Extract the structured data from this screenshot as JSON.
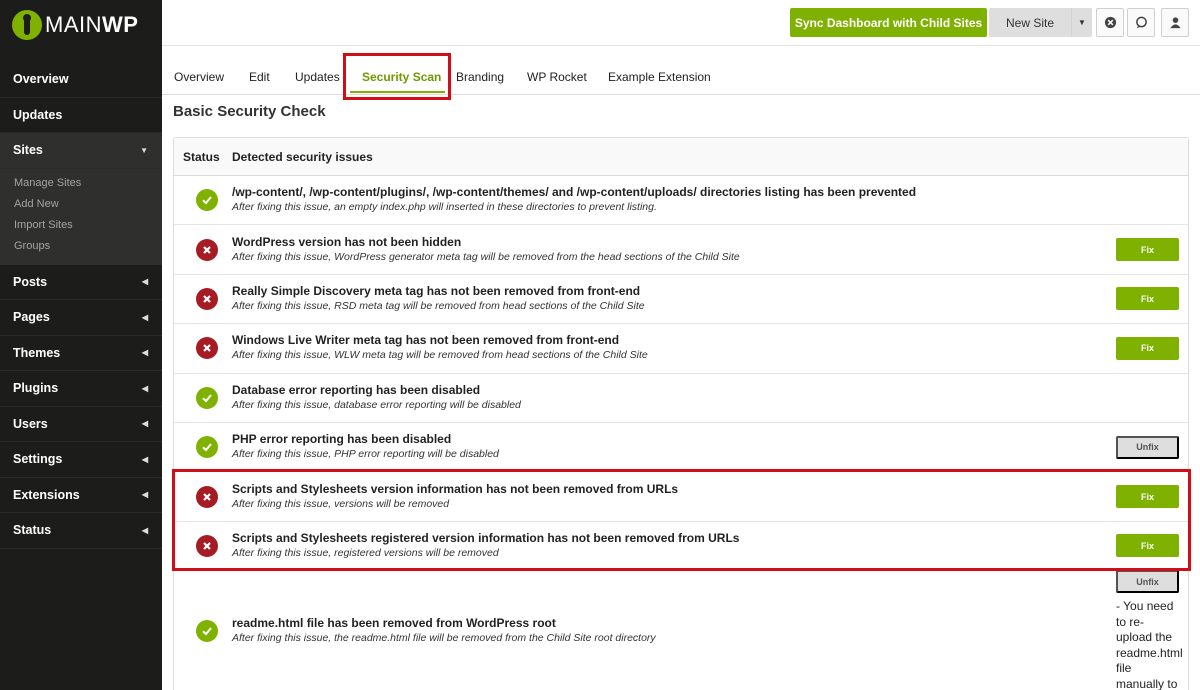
{
  "logo": {
    "main": "MAIN",
    "wp": "WP"
  },
  "sidebar": {
    "items": [
      {
        "label": "Overview"
      },
      {
        "label": "Updates"
      },
      {
        "label": "Sites"
      },
      {
        "label": "Posts"
      },
      {
        "label": "Pages"
      },
      {
        "label": "Themes"
      },
      {
        "label": "Plugins"
      },
      {
        "label": "Users"
      },
      {
        "label": "Settings"
      },
      {
        "label": "Extensions"
      },
      {
        "label": "Status"
      }
    ],
    "sites_sub": [
      "Manage Sites",
      "Add New",
      "Import Sites",
      "Groups"
    ]
  },
  "header": {
    "sync_label": "Sync Dashboard with Child Sites",
    "new_site_label": "New Site"
  },
  "tabs": [
    "Overview",
    "Edit",
    "Updates",
    "Security Scan",
    "Branding",
    "WP Rocket",
    "Example Extension"
  ],
  "section_title": "Basic Security Check",
  "table": {
    "col_status": "Status",
    "col_issues": "Detected security issues",
    "rows": [
      {
        "status": "ok",
        "title": "/wp-content/, /wp-content/plugins/, /wp-content/themes/ and /wp-content/uploads/ directories listing has been prevented",
        "desc": "After fixing this issue, an empty index.php will inserted in these directories to prevent listing.",
        "action": ""
      },
      {
        "status": "bad",
        "title": "WordPress version has not been hidden",
        "desc": "After fixing this issue, WordPress generator meta tag will be removed from the head sections of the Child Site",
        "action": "Fix"
      },
      {
        "status": "bad",
        "title": "Really Simple Discovery meta tag has not been removed from front-end",
        "desc": "After fixing this issue, RSD meta tag will be removed from head sections of the Child Site",
        "action": "Fix"
      },
      {
        "status": "bad",
        "title": "Windows Live Writer meta tag has not been removed from front-end",
        "desc": "After fixing this issue, WLW meta tag will be removed from head sections of the Child Site",
        "action": "Fix"
      },
      {
        "status": "ok",
        "title": "Database error reporting has been disabled",
        "desc": "After fixing this issue, database error reporting will be disabled",
        "action": ""
      },
      {
        "status": "ok",
        "title": "PHP error reporting has been disabled",
        "desc": "After fixing this issue, PHP error reporting will be disabled",
        "action": "Unfix"
      },
      {
        "status": "bad",
        "title": "Scripts and Stylesheets version information has not been removed from URLs",
        "desc": "After fixing this issue, versions will be removed",
        "action": "Fix"
      },
      {
        "status": "bad",
        "title": "Scripts and Stylesheets registered version information has not been removed from URLs",
        "desc": "After fixing this issue, registered versions will be removed",
        "action": "Fix"
      },
      {
        "status": "ok",
        "title": "readme.html file has been removed from WordPress root",
        "desc": "After fixing this issue, the readme.html file will be removed from the Child Site root directory",
        "action": "Unfix",
        "note": "- You need to re-upload the readme.html file manually to unfix this."
      }
    ]
  },
  "colors": {
    "accent": "#7fb100",
    "error": "#a51c24",
    "highlight": "#d10e15",
    "sidebar": "#1c1d1b"
  }
}
